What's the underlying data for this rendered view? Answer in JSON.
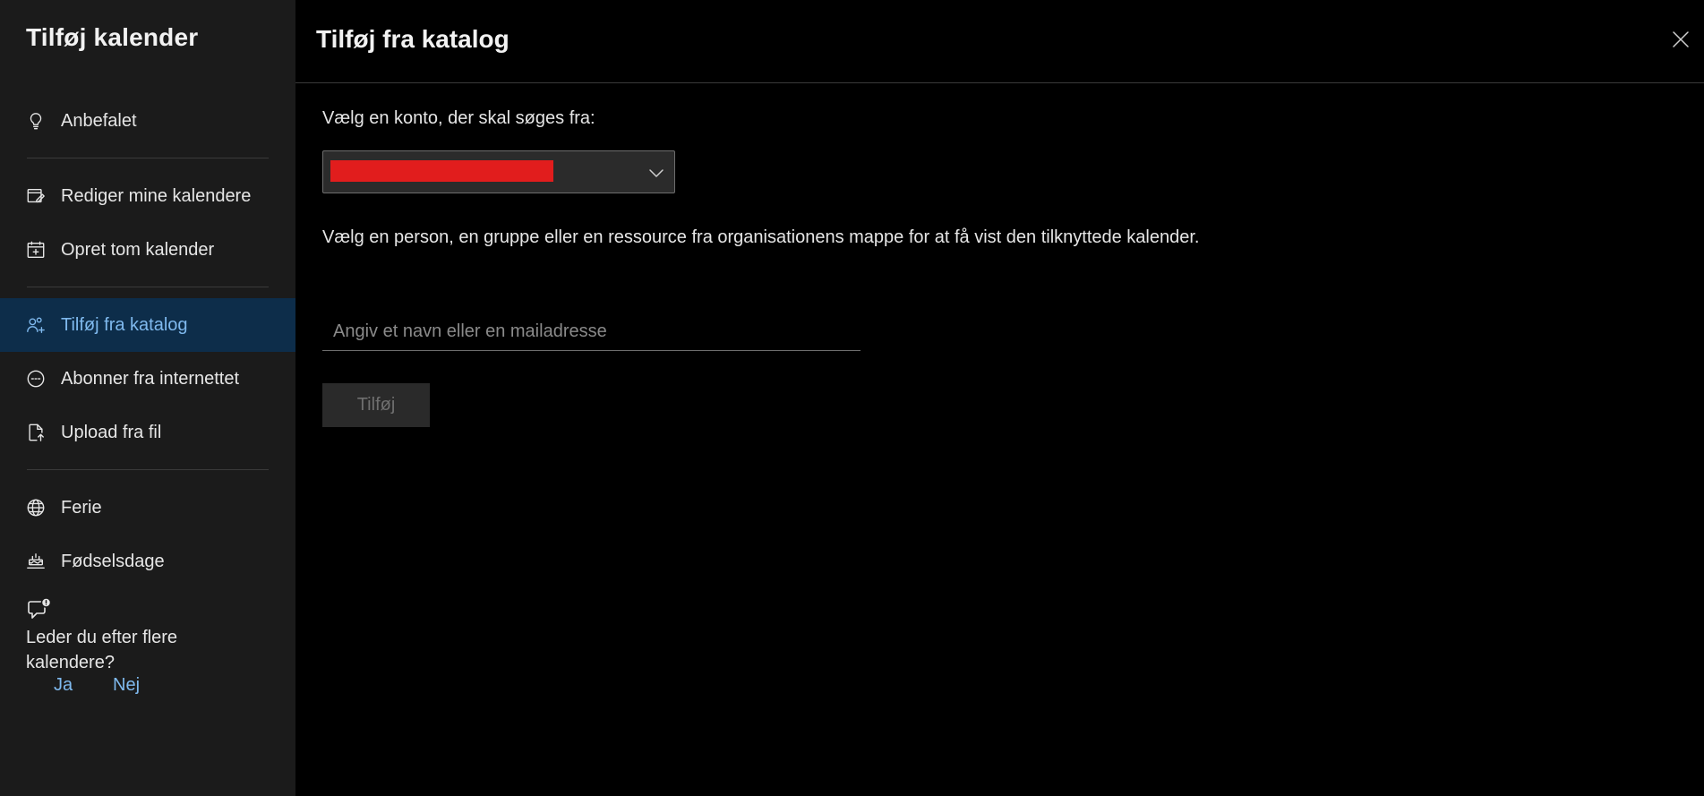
{
  "sidebar": {
    "title": "Tilføj kalender",
    "items": [
      {
        "label": "Anbefalet",
        "icon": "lightbulb-icon"
      },
      {
        "label": "Rediger mine kalendere",
        "icon": "edit-calendar-icon"
      },
      {
        "label": "Opret tom kalender",
        "icon": "calendar-add-icon"
      },
      {
        "label": "Tilføj fra katalog",
        "icon": "people-add-icon"
      },
      {
        "label": "Abonner fra internettet",
        "icon": "subscribe-icon"
      },
      {
        "label": "Upload fra fil",
        "icon": "file-upload-icon"
      },
      {
        "label": "Ferie",
        "icon": "globe-icon"
      },
      {
        "label": "Fødselsdage",
        "icon": "cake-icon"
      }
    ],
    "active_index": 3,
    "feedback": {
      "question": "Leder du efter flere kalendere?",
      "yes": "Ja",
      "no": "Nej"
    }
  },
  "main": {
    "title": "Tilføj fra katalog",
    "account_label": "Vælg en konto, der skal søges fra:",
    "account_value": "",
    "description": "Vælg en person, en gruppe eller en ressource fra organisationens mappe for at få vist den tilknyttede kalender.",
    "search_placeholder": "Angiv et navn eller en mailadresse",
    "add_button": "Tilføj"
  },
  "colors": {
    "sidebar_bg": "#1b1b1b",
    "main_bg": "#000000",
    "active_bg": "#0d2d4a",
    "accent": "#7fb9ee",
    "redaction": "#e11d1d"
  }
}
